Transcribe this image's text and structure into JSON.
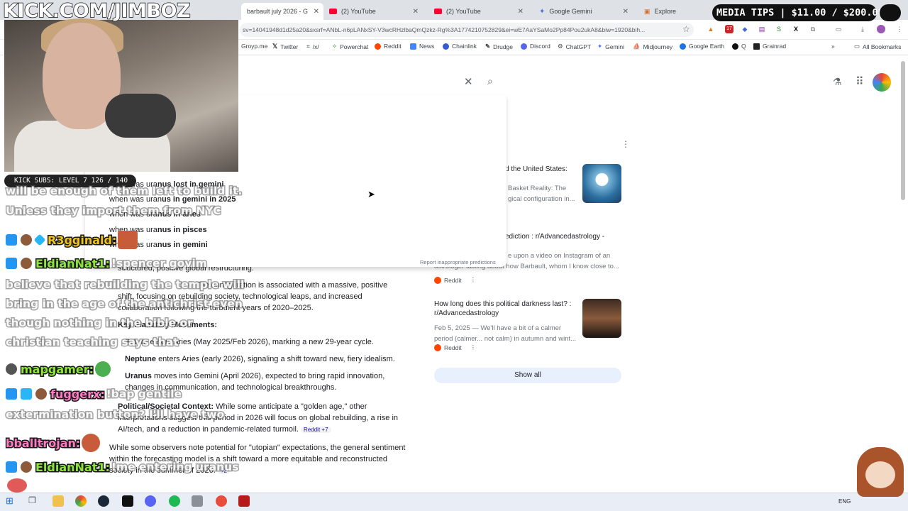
{
  "browser": {
    "tabs": [
      {
        "label": "barbault july 2026 - G"
      },
      {
        "label": "(2) YouTube"
      },
      {
        "label": "(2) YouTube"
      },
      {
        "label": "Google Gemini"
      },
      {
        "label": "Explore"
      }
    ],
    "url": "sv=14041948d1d25a20&sxsrf=ANbL-n6pLANxSY-V3wcRHzlbaQmQzkz-Rg%3A1774210752829&ei=wE7AaYSaMo2Pp84Pou2ukA8&biw=1920&bih...",
    "bookmarks": [
      "Groyp.me",
      "Twitter",
      "/x/",
      "Powerchat",
      "Reddit",
      "News",
      "Chainlink",
      "Drudge",
      "Discord",
      "ChatGPT",
      "Gemini",
      "Midjourney",
      "Google Earth",
      "Q",
      "Grainrad"
    ],
    "all_bookmarks": "All Bookmarks"
  },
  "search": {
    "suggestions": [
      {
        "prefix": "when was ura",
        "bold": "nus lost in gemini"
      },
      {
        "prefix": "when was uran",
        "bold": "us in gemini in 2025"
      },
      {
        "prefix": "when was ura",
        "bold": "nus in aries"
      },
      {
        "prefix": "when was ura",
        "bold": "nus in pisces"
      },
      {
        "prefix": "when was ura",
        "bold": "nus in gemini"
      }
    ],
    "report": "Report inappropriate predictions"
  },
  "ai_overview": {
    "line1": "structured, positive global restructuring.",
    "para_a": "The configuration is associated with a massive, positive",
    "para_b": "shift, focusing on rebuilding society, technological leaps, and increased",
    "para_c": "collaboration following the turbulent years of 2020–2025.",
    "heading": "Key Planetary Movements:",
    "saturn": "Saturn enters Aries (May 2025/Feb 2026), marking a new 29-year cycle.",
    "neptune_label": "Neptune",
    "neptune": "enters Aries (early 2026), signaling a shift toward new, fiery idealism.",
    "uranus_label": "Uranus",
    "uranus_a": "moves into Gemini (April 2026), expected to bring rapid innovation,",
    "uranus_b": "changes in communication, and technological breakthroughs.",
    "political_label": "Political/Societal Context:",
    "political_a": "While some anticipate a \"golden age,\" other",
    "political_b": "interpretations suggest this period in 2026 will focus on global rebuilding, a rise in",
    "political_c": "AI/tech, and a reduction in pandemic-related turmoil.",
    "source1": "Reddit +7",
    "closing_a": "While some observers note potential for \"utopian\" expectations, the general sentiment",
    "closing_b": "within the forecasting model is a shift toward a more equitable and reconstructed",
    "closing_c": "society in the summer of 2026.",
    "source2": "+2"
  },
  "right_panel": {
    "card1_title": "d the United States:",
    "card1_sub_a": "Basket Reality: The",
    "card1_sub_b": "gical configuration in...",
    "card2_title": "ediction : r/Advancedastrology -",
    "card2_sub_a": "e upon a video on Instagram of an",
    "card2_sub_b": "astrologer talking about how Barbault, whom I know close to...",
    "card2_source": "Reddit",
    "card3_title_a": "How long does this political darkness last? :",
    "card3_title_b": "r/Advancedastrology",
    "card3_sub_a": "Feb 5, 2025 — We'll have a bit of a calmer",
    "card3_sub_b": "period (calmer... not calm) in autumn and wint...",
    "card3_source": "Reddit",
    "show_all": "Show all"
  },
  "overlay": {
    "logo": "KICK.COM/JIMBOZ",
    "subs": "KICK SUBS: LEVEL 7 126 / 140",
    "media_tips": "MEDIA TIPS | $11.00 / $200.00",
    "chat": [
      {
        "user": "",
        "text": "will be enough of them left to build it."
      },
      {
        "user": "",
        "text": "Unless they import them from NYC"
      },
      {
        "user": "R3gginald:",
        "text": ""
      },
      {
        "user": "EldianNat1:",
        "text": "!spencer govim"
      },
      {
        "user": "",
        "text": "believe that rebuilding the temple will"
      },
      {
        "user": "",
        "text": "bring in the age of the antichrist even"
      },
      {
        "user": "",
        "text": "though nothing in the bible or"
      },
      {
        "user": "",
        "text": "christian teaching says that"
      },
      {
        "user": "mapgamer:",
        "text": ""
      },
      {
        "user": "fuggerx:",
        "text": "!bap gentile"
      },
      {
        "user": "",
        "text": "extermination button? I'll have two"
      },
      {
        "user": "bballtrojan:",
        "text": ""
      },
      {
        "user": "EldianNat1:",
        "text": "!me entering uranus"
      }
    ]
  },
  "taskbar": {
    "lang": "ENG"
  },
  "colors": {
    "accent": "#1a73e8",
    "reddit": "#ff4500",
    "user_green": "#8ee63a",
    "user_pink": "#ff7bc4",
    "user_yellow": "#f0c419"
  }
}
